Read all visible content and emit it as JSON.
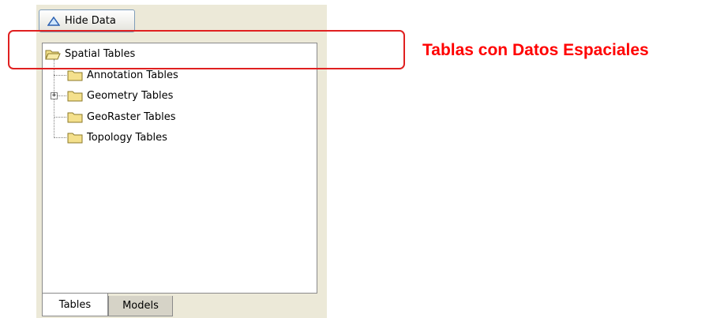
{
  "toolbar": {
    "hide_data_label": "Hide Data"
  },
  "tree": {
    "root_label": "Spatial Tables",
    "children": [
      {
        "label": "Annotation Tables",
        "expandable": false
      },
      {
        "label": "Geometry Tables",
        "expandable": true
      },
      {
        "label": "GeoRaster Tables",
        "expandable": false
      },
      {
        "label": "Topology Tables",
        "expandable": false
      }
    ]
  },
  "tabs": [
    {
      "label": "Tables",
      "active": true
    },
    {
      "label": "Models",
      "active": false
    }
  ],
  "annotation": {
    "text": "Tablas con Datos Espaciales",
    "color": "#ff0000"
  },
  "icons": {
    "hide_data": "triangle-up-icon",
    "folder": "folder-icon",
    "expander": "plus-icon"
  }
}
